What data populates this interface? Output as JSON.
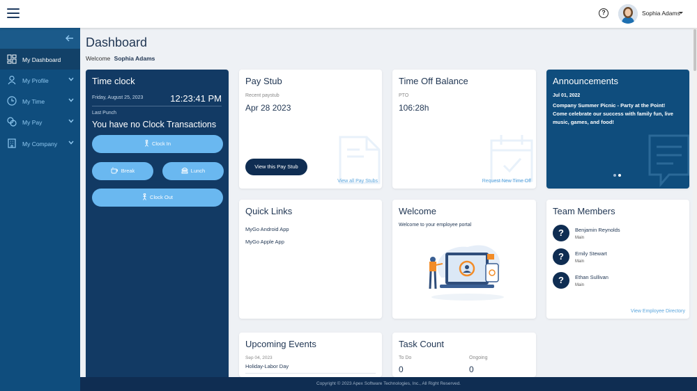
{
  "topbar": {
    "user_name": "Sophia Adams",
    "help_glyph": "?"
  },
  "sidebar": {
    "items": [
      {
        "label": "My Dashboard",
        "icon": "dashboard-icon",
        "active": true
      },
      {
        "label": "My Profile",
        "icon": "person-icon"
      },
      {
        "label": "My Time",
        "icon": "clock-icon"
      },
      {
        "label": "My Pay",
        "icon": "coins-icon"
      },
      {
        "label": "My Company",
        "icon": "building-icon"
      }
    ]
  },
  "header": {
    "title": "Dashboard",
    "welcome_prefix": "Welcome",
    "welcome_name": "Sophia Adams"
  },
  "timeclock": {
    "title": "Time clock",
    "date": "Friday, August 25, 2023",
    "time": "12:23:41 PM",
    "last_punch_label": "Last Punch",
    "last_punch_value": "You have no Clock Transactions",
    "clock_in": "Clock In",
    "break": "Break",
    "lunch": "Lunch",
    "clock_out": "Clock Out"
  },
  "paystub": {
    "title": "Pay Stub",
    "sub_label": "Recent paystub",
    "date": "Apr 28 2023",
    "button": "View this Pay Stub",
    "link": "View all Pay Stubs"
  },
  "timeoff": {
    "title": "Time Off Balance",
    "sub_label": "PTO",
    "value": "106:28h",
    "link": "Request New Time Off"
  },
  "announcements": {
    "title": "Announcements",
    "date": "Jul 01, 2022",
    "text": "Company Summer Picnic - Party at the Point! Come celebrate our success with family fun, live music, games, and food!"
  },
  "quicklinks": {
    "title": "Quick Links",
    "items": [
      "MyGo Android App",
      "MyGo Apple App"
    ]
  },
  "welcome_card": {
    "title": "Welcome",
    "text": "Welcome to your employee portal"
  },
  "team": {
    "title": "Team Members",
    "members": [
      {
        "name": "Benjamin Reynolds",
        "location": "Main"
      },
      {
        "name": "Emily Stewart",
        "location": "Main"
      },
      {
        "name": "Ethan Sullivan",
        "location": "Main"
      }
    ],
    "link": "View Employee Directory"
  },
  "events": {
    "title": "Upcoming Events",
    "date": "Sep 04, 2023",
    "name": "Holiday-Labor Day"
  },
  "tasks": {
    "title": "Task Count",
    "todo_label": "To Do",
    "todo_value": "0",
    "ongoing_label": "Ongoing",
    "ongoing_value": "0"
  },
  "footer": {
    "text": "Copyright © 2023 Apex Software Technologies, Inc., All Right Reserved."
  },
  "colors": {
    "sidebar": "#0f4d7d",
    "timeclock": "#123a64",
    "accent": "#6ab8f0",
    "dark_button": "#0f2d52"
  }
}
